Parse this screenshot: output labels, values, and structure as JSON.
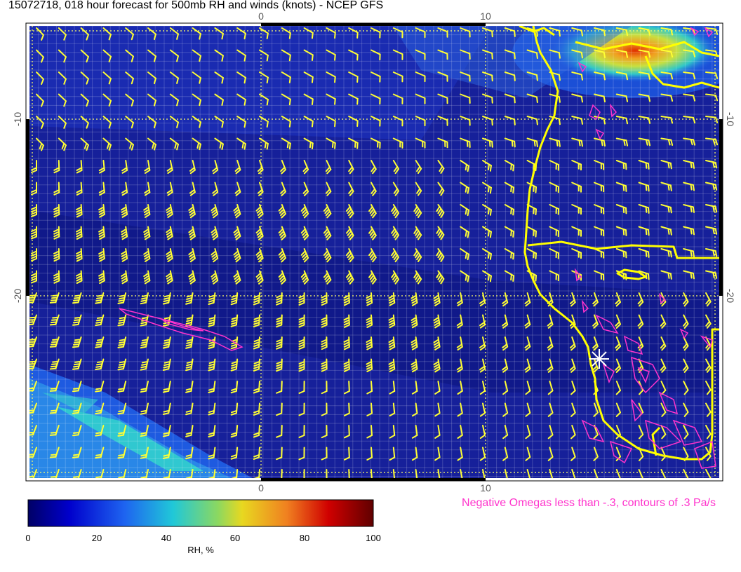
{
  "title": "15072718, 018 hour forecast for 500mb RH and winds (knots) - NCEP GFS",
  "top_axis_ticks": [
    "0",
    "10"
  ],
  "bottom_axis_ticks": [
    "0",
    "10"
  ],
  "left_axis_ticks": [
    "-10",
    "-20"
  ],
  "right_axis_ticks": [
    "-10",
    "-20"
  ],
  "omega_note": "Negative Omegas less than -.3, contours of .3 Pa/s",
  "colorbar": {
    "label": "RH, %",
    "ticks": [
      "0",
      "20",
      "40",
      "60",
      "80",
      "100"
    ],
    "stops": [
      "#000066",
      "#0000cc",
      "#1e64f0",
      "#20c8d8",
      "#8cd860",
      "#e8d820",
      "#f08020",
      "#d00000",
      "#600000"
    ]
  },
  "colors": {
    "wind_barb": "#ffff33",
    "coastline": "#ffff00",
    "omega_contour": "#ff33cc",
    "grid_line": "#ffff66",
    "ocean_bg": "#16209a"
  },
  "icons": {
    "station_marker": "asterisk-icon"
  }
}
